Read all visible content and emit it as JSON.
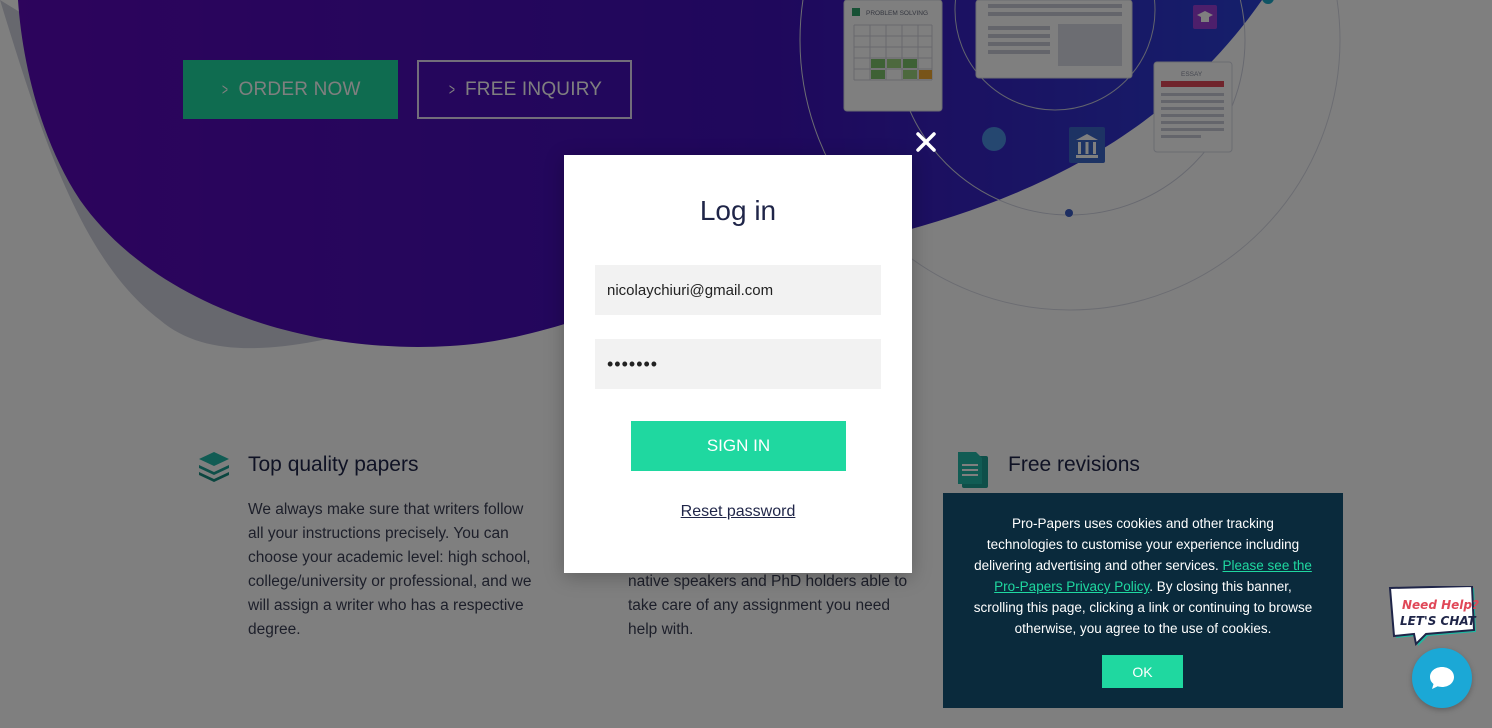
{
  "hero": {
    "order_button": "ORDER NOW",
    "inquiry_button": "FREE INQUIRY",
    "doc_problem_label": "PROBLEM SOLVING",
    "doc_essay_label": "ESSAY"
  },
  "features": [
    {
      "title": "Top quality papers",
      "text": "We always make sure that writers follow all your instructions precisely. You can choose your academic level: high school, college/university or professional, and we will assign a writer who has a respective degree."
    },
    {
      "title": "",
      "text": "native speakers and PhD holders able to take care of any assignment you need help with."
    },
    {
      "title": "Free revisions",
      "text": ""
    }
  ],
  "login": {
    "title": "Log in",
    "email_value": "nicolaychiuri@gmail.com",
    "password_value": "•••••••",
    "sign_in": "SIGN IN",
    "reset_password": "Reset password"
  },
  "cookie": {
    "text_before": "Pro-Papers uses cookies and other tracking technologies to customise your experience including delivering advertising and other services. ",
    "link_text": "Please see the Pro-Papers Privacy Policy",
    "text_after": ". By closing this banner, scrolling this page, clicking a link or continuing to browse otherwise, you agree to the use of cookies.",
    "ok_label": "OK"
  },
  "chat": {
    "badge_line1": "Need Help?",
    "badge_line2": "LET'S CHAT"
  },
  "colors": {
    "accent": "#1fd8a0",
    "hero_purple": "#4b0bbf",
    "cookie_bg": "#0a2a3c",
    "chat_blue": "#1ba8d6"
  }
}
